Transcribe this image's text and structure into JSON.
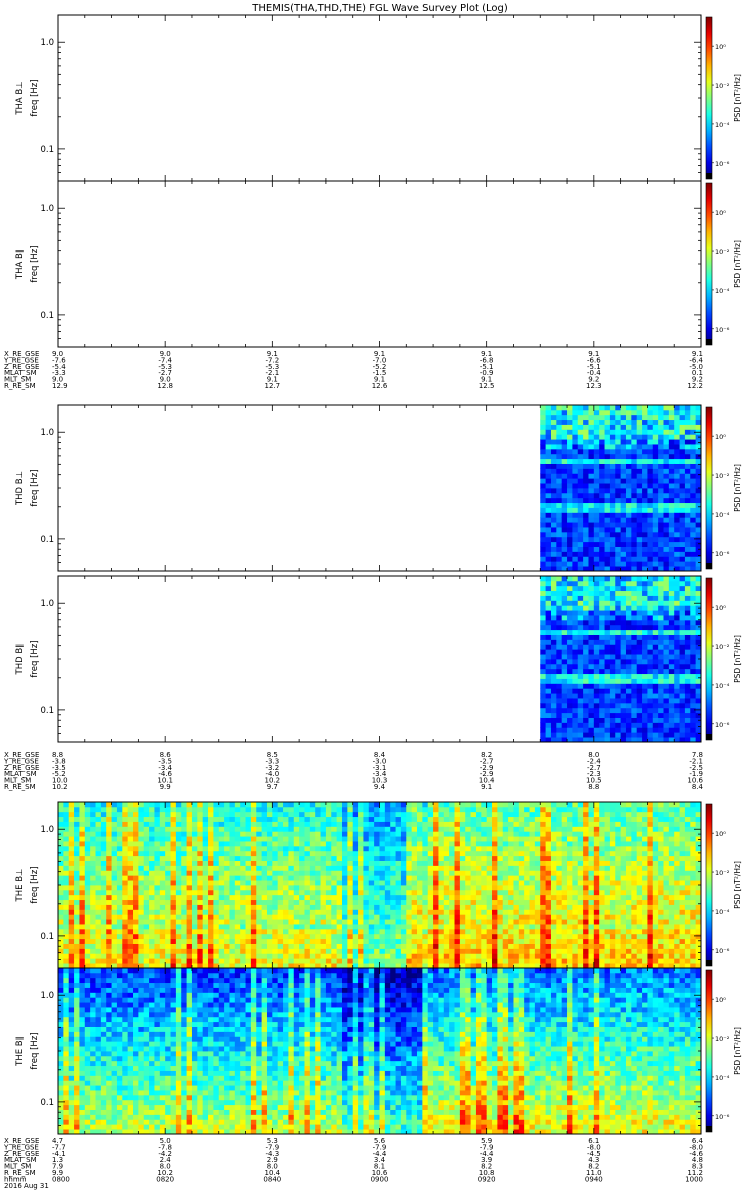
{
  "title": "THEMIS(THA,THD,THE) FGL Wave Survey Plot (Log)",
  "colorbar_label": "PSD [nT²/Hz]",
  "colorbar_ticks": [
    "10⁰",
    "10⁻²",
    "10⁻⁴",
    "10⁻⁶"
  ],
  "chart_data": {
    "type": "heatmap",
    "yscale": "log",
    "ylim": [
      0.05,
      1.8
    ],
    "yticks": [
      0.1,
      1.0
    ],
    "ytick_labels": [
      "0.1",
      "1.0"
    ],
    "ylabel_unit": "freq [Hz]",
    "colorscale": "log",
    "clim": [
      1e-07,
      10
    ],
    "panels": [
      {
        "name": "THA B⊥",
        "has_data": false
      },
      {
        "name": "THA B∥",
        "has_data": false
      },
      {
        "name": "THD B⊥",
        "has_data": true,
        "data_start": "0930"
      },
      {
        "name": "THD B∥",
        "has_data": true,
        "data_start": "0930"
      },
      {
        "name": "THE B⊥",
        "has_data": true,
        "data_start": "0800"
      },
      {
        "name": "THE B∥",
        "has_data": true,
        "data_start": "0800"
      }
    ],
    "ephemeris": [
      {
        "probe": "THA",
        "labels": [
          "X_RE_GSE",
          "Y_RE_GSE",
          "Z_RE_GSE",
          "MLAT_SM",
          "MLT_SM",
          "R_RE_SM"
        ],
        "rows": [
          [
            "9.0",
            "9.0",
            "9.1",
            "9.1",
            "9.1",
            "9.1",
            "9.1"
          ],
          [
            "-7.6",
            "-7.4",
            "-7.2",
            "-7.0",
            "-6.8",
            "-6.6",
            "-6.4"
          ],
          [
            "-5.4",
            "-5.3",
            "-5.3",
            "-5.2",
            "-5.1",
            "-5.1",
            "-5.0"
          ],
          [
            "-3.3",
            "-2.7",
            "-2.1",
            "-1.5",
            "-0.9",
            "-0.4",
            "0.1"
          ],
          [
            "9.0",
            "9.0",
            "9.1",
            "9.1",
            "9.1",
            "9.2",
            "9.2"
          ],
          [
            "12.9",
            "12.8",
            "12.7",
            "12.6",
            "12.5",
            "12.3",
            "12.2"
          ]
        ]
      },
      {
        "probe": "THD",
        "labels": [
          "X_RE_GSE",
          "Y_RE_GSE",
          "Z_RE_GSE",
          "MLAT_SM",
          "MLT_SM",
          "R_RE_SM"
        ],
        "rows": [
          [
            "8.8",
            "8.6",
            "8.5",
            "8.4",
            "8.2",
            "8.0",
            "7.8"
          ],
          [
            "-3.8",
            "-3.5",
            "-3.3",
            "-3.0",
            "-2.7",
            "-2.4",
            "-2.1"
          ],
          [
            "-3.5",
            "-3.4",
            "-3.2",
            "-3.1",
            "-2.9",
            "-2.7",
            "-2.5"
          ],
          [
            "-5.2",
            "-4.6",
            "-4.0",
            "-3.4",
            "-2.9",
            "-2.3",
            "-1.9"
          ],
          [
            "10.0",
            "10.1",
            "10.2",
            "10.3",
            "10.4",
            "10.5",
            "10.6"
          ],
          [
            "10.2",
            "9.9",
            "9.7",
            "9.4",
            "9.1",
            "8.8",
            "8.4"
          ]
        ]
      },
      {
        "probe": "THE",
        "labels": [
          "X_RE_GSE",
          "Y_RE_GSE",
          "Z_RE_GSE",
          "MLAT_SM",
          "MLT_SM",
          "R_RE_SM",
          "hhmm",
          "2016 Aug 31"
        ],
        "rows": [
          [
            "4.7",
            "5.0",
            "5.3",
            "5.6",
            "5.9",
            "6.1",
            "6.4"
          ],
          [
            "-7.7",
            "-7.8",
            "-7.9",
            "-7.9",
            "-7.9",
            "-8.0",
            "-8.0"
          ],
          [
            "-4.1",
            "-4.2",
            "-4.3",
            "-4.4",
            "-4.4",
            "-4.5",
            "-4.6"
          ],
          [
            "1.3",
            "2.4",
            "2.9",
            "3.4",
            "3.9",
            "4.3",
            "4.8"
          ],
          [
            "7.9",
            "8.0",
            "8.0",
            "8.1",
            "8.2",
            "8.2",
            "8.3"
          ],
          [
            "9.9",
            "10.2",
            "10.4",
            "10.6",
            "10.8",
            "11.0",
            "11.2"
          ],
          [
            "0800",
            "0820",
            "0840",
            "0900",
            "0920",
            "0940",
            "1000"
          ]
        ]
      }
    ]
  }
}
